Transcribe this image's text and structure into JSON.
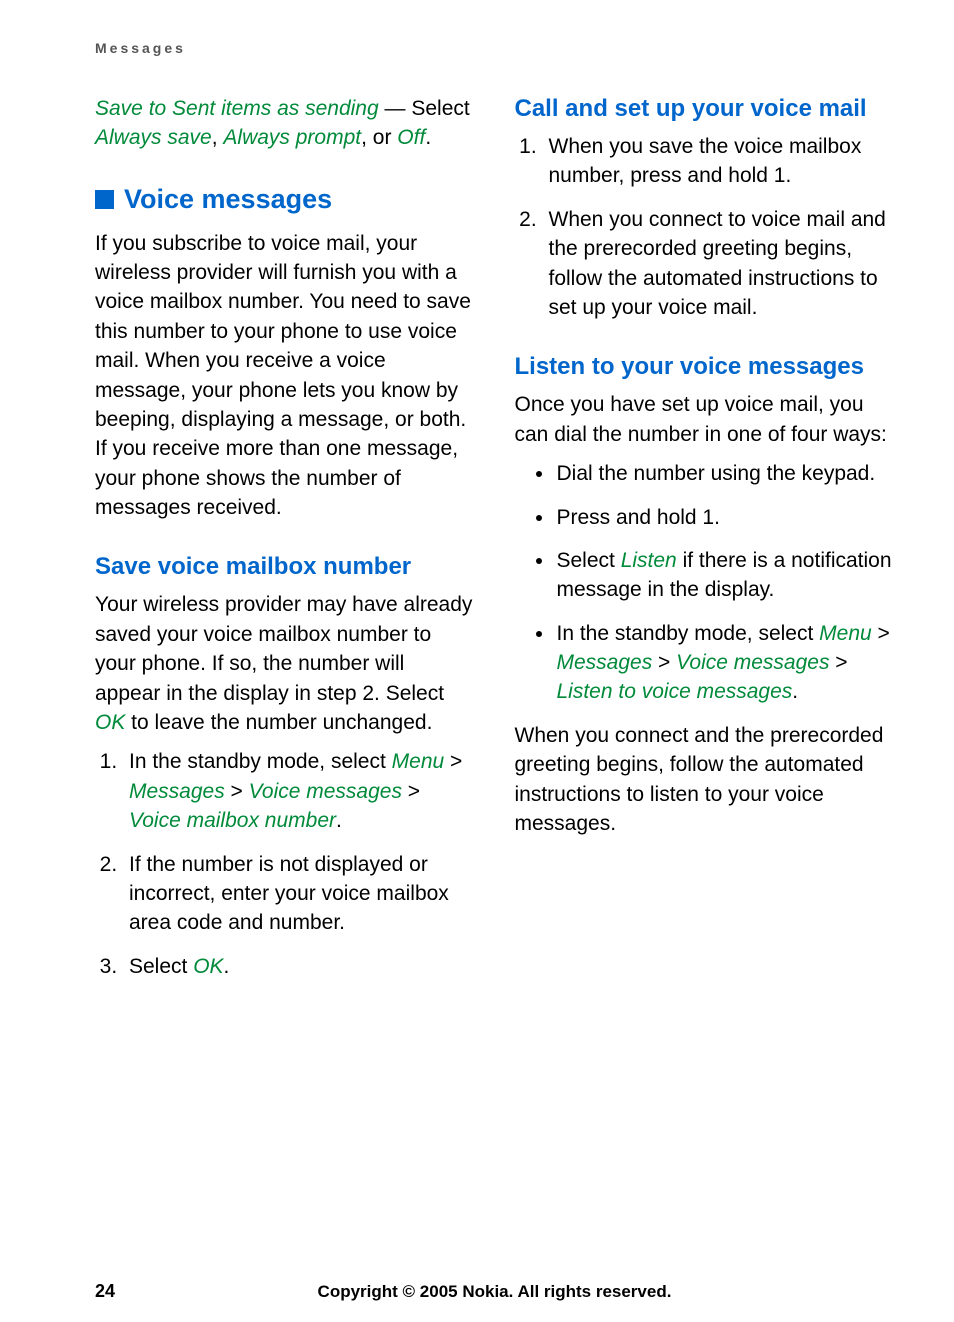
{
  "header": "Messages",
  "left": {
    "intro": {
      "term_save": "Save to Sent items as sending",
      "dash": " — Select ",
      "opt1": "Always save",
      "sep1": ", ",
      "opt2": "Always prompt",
      "sep2": ", or ",
      "opt3": "Off",
      "end": "."
    },
    "h1": "Voice messages",
    "p1": "If you subscribe to voice mail, your wireless provider will furnish you with a voice mailbox number. You need to save this number to your phone to use voice mail. When you receive a voice message, your phone lets you know by beeping, displaying a message, or both. If you receive more than one message, your phone shows the number of messages received.",
    "h2a": "Save voice mailbox number",
    "p2_pre": "Your wireless provider may have already saved your voice mailbox number to your phone. If so, the number will appear in the display in step 2. Select ",
    "p2_ok": "OK",
    "p2_post": " to leave the number unchanged.",
    "ol": {
      "i1_pre": "In the standby mode, select ",
      "i1_menu": "Menu",
      "gt": " > ",
      "i1_messages": "Messages",
      "i1_vm": "Voice messages",
      "i1_vmn": "Voice mailbox number",
      "i1_end": ".",
      "i2": "If the number is not displayed or incorrect, enter your voice mailbox area code and number.",
      "i3_pre": "Select ",
      "i3_ok": "OK",
      "i3_end": "."
    }
  },
  "right": {
    "h2a": "Call and set up your voice mail",
    "ol": {
      "i1": "When you save the voice mailbox number, press and hold 1.",
      "i2": "When you connect to voice mail and the prerecorded greeting begins, follow the automated instructions to set up your voice mail."
    },
    "h2b": "Listen to your voice messages",
    "p1": "Once you have set up voice mail, you can dial the number in one of four ways:",
    "ul": {
      "i1": "Dial the number using the keypad.",
      "i2": "Press and hold 1.",
      "i3_pre": "Select ",
      "i3_listen": "Listen",
      "i3_post": " if there is a notification message in the display.",
      "i4_pre": "In the standby mode, select ",
      "i4_menu": "Menu",
      "gt": " > ",
      "i4_messages": "Messages",
      "i4_vm": "Voice messages",
      "i4_lvm": "Listen to voice messages",
      "i4_end": "."
    },
    "p2": "When you connect and the prerecorded greeting begins, follow the automated instructions to listen to your voice messages."
  },
  "footer": {
    "page": "24",
    "copyright": "Copyright © 2005 Nokia. All rights reserved."
  }
}
